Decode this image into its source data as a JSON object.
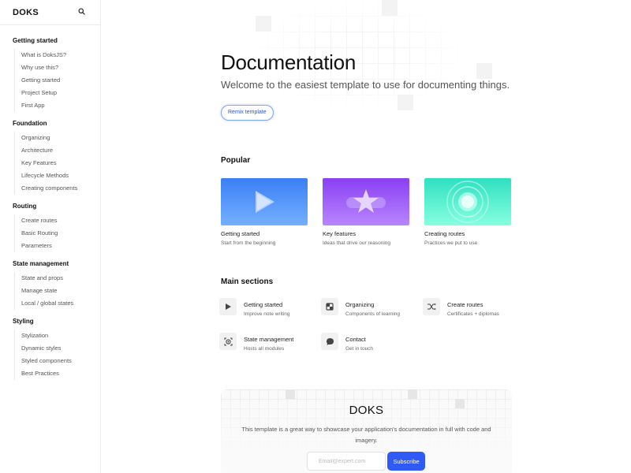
{
  "sidebar": {
    "logo": "DOKS",
    "groups": [
      {
        "title": "Getting started",
        "items": [
          "What is DoksJS?",
          "Why use this?",
          "Getting started",
          "Project Setup",
          "First App"
        ]
      },
      {
        "title": "Foundation",
        "items": [
          "Organizing",
          "Architecture",
          "Key Features",
          "Lifecycle Methods",
          "Creating components"
        ]
      },
      {
        "title": "Routing",
        "items": [
          "Create routes",
          "Basic Routing",
          "Parameters"
        ]
      },
      {
        "title": "State management",
        "items": [
          "State and props",
          "Manage state",
          "Local / global states"
        ]
      },
      {
        "title": "Styling",
        "items": [
          "Stylization",
          "Dynamic styles",
          "Styled components",
          "Best Practices"
        ]
      }
    ]
  },
  "hero": {
    "title": "Documentation",
    "subtitle": "Welcome to the easiest template to use for documenting things.",
    "button_label": "Remix template"
  },
  "popular": {
    "title": "Popular",
    "cards": [
      {
        "title": "Getting started",
        "subtitle": "Start from the beginning",
        "theme": "blue",
        "icon": "play-icon"
      },
      {
        "title": "Key features",
        "subtitle": "Ideas that drive our reasoning",
        "theme": "purple",
        "icon": "star-icon"
      },
      {
        "title": "Creating routes",
        "subtitle": "Practices we put to use",
        "theme": "green",
        "icon": "radar-icon"
      }
    ]
  },
  "main_sections": {
    "title": "Main sections",
    "items": [
      {
        "title": "Getting started",
        "subtitle": "Improve note writing",
        "icon": "play-icon"
      },
      {
        "title": "Organizing",
        "subtitle": "Components of learning",
        "icon": "layout-icon"
      },
      {
        "title": "Create routes",
        "subtitle": "Certificates + diplomas",
        "icon": "shuffle-icon"
      },
      {
        "title": "State management",
        "subtitle": "Hosts all modules",
        "icon": "target-icon"
      },
      {
        "title": "Contact",
        "subtitle": "Get in touch",
        "icon": "chat-icon"
      }
    ]
  },
  "promo": {
    "title": "DOKS",
    "description": "This template is a great way to showcase your application's documentation in full with code and imagery.",
    "email_placeholder": "Email@expert.com",
    "subscribe_label": "Subscribe"
  },
  "colors": {
    "accent": "#2f5af6",
    "card_blue": "#3b7ff5",
    "card_purple": "#8a3ff2",
    "card_green": "#2fe0c0"
  }
}
